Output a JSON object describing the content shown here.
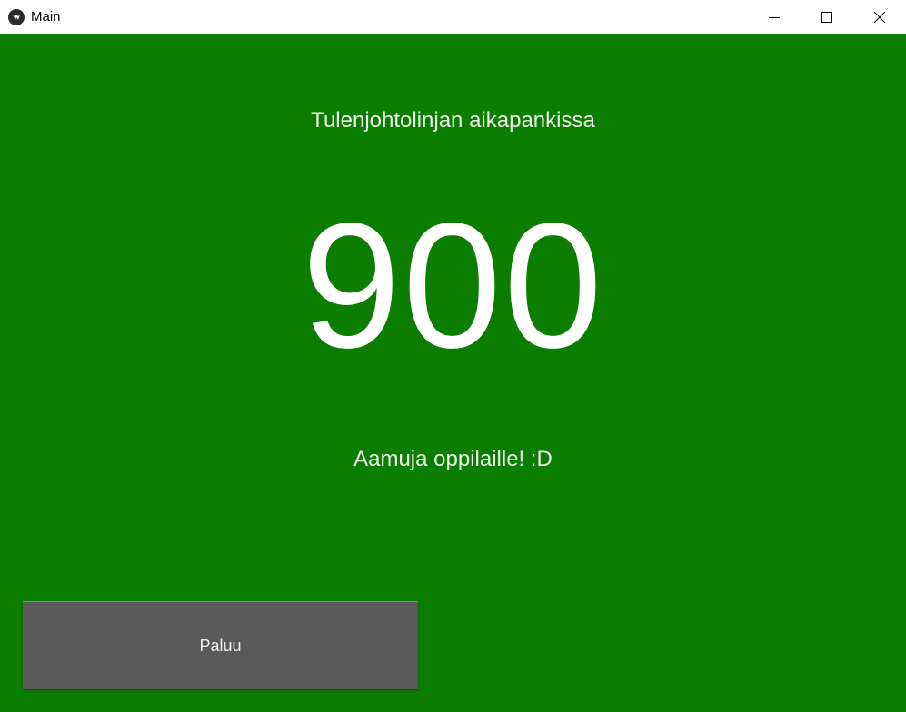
{
  "window": {
    "title": "Main",
    "icon": "kivy-app-icon",
    "controls": [
      "minimize-icon",
      "maximize-icon",
      "close-icon"
    ],
    "background_color": "#0b7d00"
  },
  "screen": {
    "heading": "Tulenjohtolinjan aikapankissa",
    "value": "900",
    "message": "Aamuja oppilaille! :D",
    "back_button_label": "Paluu",
    "button_color": "#595959"
  }
}
